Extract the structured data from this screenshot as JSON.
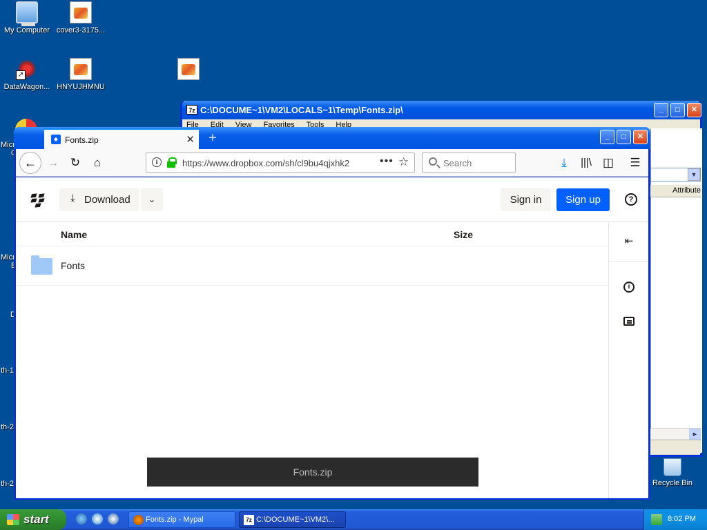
{
  "desktop": {
    "icons": [
      {
        "label": "My Computer",
        "icon": "my-computer-icon"
      },
      {
        "label": "cover3-3175...",
        "icon": "image-file-icon"
      },
      {
        "label": "DataWagon...",
        "icon": "shortcut-icon"
      },
      {
        "label": "HNYUJHMNU",
        "icon": "image-file-icon"
      },
      {
        "label": "Recycle Bin",
        "icon": "recycle-bin-icon"
      }
    ],
    "partial_labels": [
      "Micr",
      "C",
      "Micr",
      "E",
      "D",
      "th-1",
      "th-2",
      "th-2"
    ]
  },
  "sevenzip": {
    "title": "C:\\DOCUME~1\\VM2\\LOCALS~1\\Temp\\Fonts.zip\\",
    "app_badge": "7z",
    "menu": [
      "File",
      "Edit",
      "View",
      "Favorites",
      "Tools",
      "Help"
    ],
    "column_visible": "Attribute"
  },
  "firefox": {
    "tab_title": "Fonts.zip",
    "url": "https://www.dropbox.com/sh/cl9bu4qjxhk2",
    "search_placeholder": "Search"
  },
  "dropbox": {
    "download_label": "Download",
    "signin_label": "Sign in",
    "signup_label": "Sign up",
    "columns": {
      "name": "Name",
      "size": "Size"
    },
    "files": [
      {
        "name": "Fonts",
        "type": "folder",
        "size": ""
      }
    ],
    "toast": "Fonts.zip",
    "colors": {
      "accent": "#0061fe",
      "folder": "#a1c9f7"
    }
  },
  "taskbar": {
    "start_label": "start",
    "buttons": [
      {
        "label": "Fonts.zip - Mypal"
      },
      {
        "label": "C:\\DOCUME~1\\VM2\\..."
      }
    ],
    "clock": "8:02 PM"
  }
}
